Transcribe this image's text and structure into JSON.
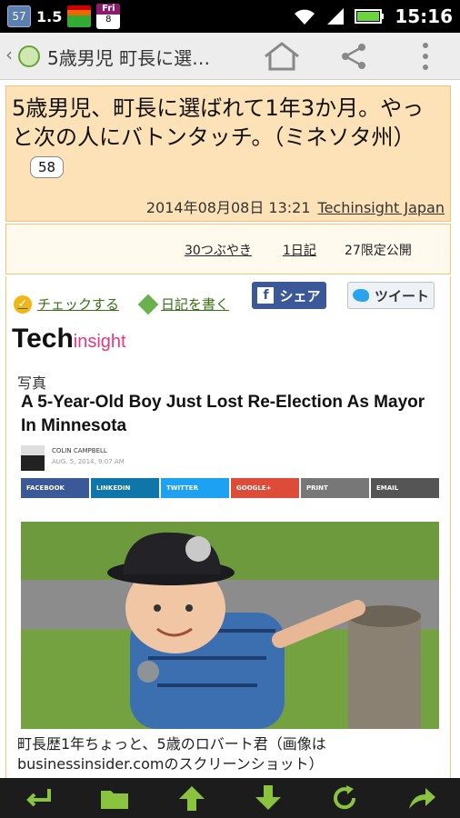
{
  "status_bar": {
    "notif_count": "57",
    "version": "1.5",
    "calendar_day": "Fri",
    "calendar_date": "8",
    "time": "15:16"
  },
  "action_bar": {
    "title": "5歳男児 町長に選…"
  },
  "header": {
    "headline": "5歳男児、町長に選ばれて1年3か月。やっと次の人にバトンタッチ。（ミネソタ州）",
    "comment_count": "58",
    "datetime": "2014年08月08日 13:21",
    "source": "Techinsight Japan"
  },
  "stats": {
    "tweets": "30つぶやき",
    "diary": "1日記",
    "private": "27限定公開"
  },
  "actions": {
    "check": "チェックする",
    "write_diary": "日記を書く",
    "fb_share": "シェア",
    "tweet": "ツイート"
  },
  "article": {
    "logo_main": "Tech",
    "logo_sub": "insight",
    "photo_label": "写真",
    "title": "A 5-Year-Old Boy Just Lost Re-Election As Mayor In Minnesota",
    "author": "COLIN CAMPBELL",
    "meta": "AUG. 5, 2014, 9:07 AM",
    "share_buttons": [
      "FACEBOOK",
      "LINKEDIN",
      "TWITTER",
      "GOOGLE+",
      "PRINT",
      "EMAIL"
    ],
    "caption": "町長歴1年ちょっと、5歳のロバート君（画像はbusinessinsider.comのスクリーンショット）"
  },
  "colors": {
    "header_bg": "#fde2b8",
    "link_green": "#3b6e16",
    "facebook": "#3b5998",
    "linkedin": "#0e76a8",
    "twitter": "#1da1f2",
    "google": "#dd4b39",
    "print": "#777777",
    "email": "#555555"
  }
}
